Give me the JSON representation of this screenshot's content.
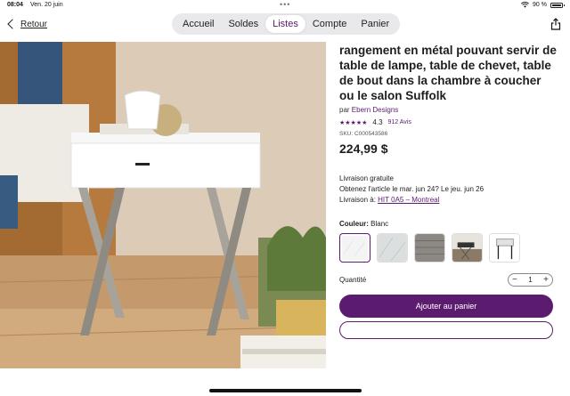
{
  "status_bar": {
    "time": "08:04",
    "date": "Ven. 20 juin",
    "battery": "90 %"
  },
  "nav": {
    "back_label": "Retour",
    "tabs": [
      "Accueil",
      "Soldes",
      "Listes",
      "Compte",
      "Panier"
    ],
    "active_tab": "Listes"
  },
  "product": {
    "title": "rangement en métal pouvant servir de table de lampe, table de chevet, table de bout dans la chambre à coucher ou le salon Suffolk",
    "brand_prefix": "par",
    "brand": "Ebern Designs",
    "rating": "4.3",
    "reviews": "912 Avis",
    "sku": "SKU: C000543586",
    "price": "224,99 $",
    "shipping_free": "Livraison gratuite",
    "delivery_estimate": "Obtenez l'article le mar. jun 24? Le jeu. jun 26",
    "delivery_to_label": "Livraison à:",
    "delivery_to_value": "HIT 0A5 – Montreal",
    "color_label": "Couleur:",
    "color_value": "Blanc",
    "quantity_label": "Quantité",
    "quantity_value": "1",
    "add_to_cart": "Ajouter au panier"
  },
  "colors": {
    "accent": "#5b1b6e",
    "tab_bg": "#e9e9ec"
  }
}
